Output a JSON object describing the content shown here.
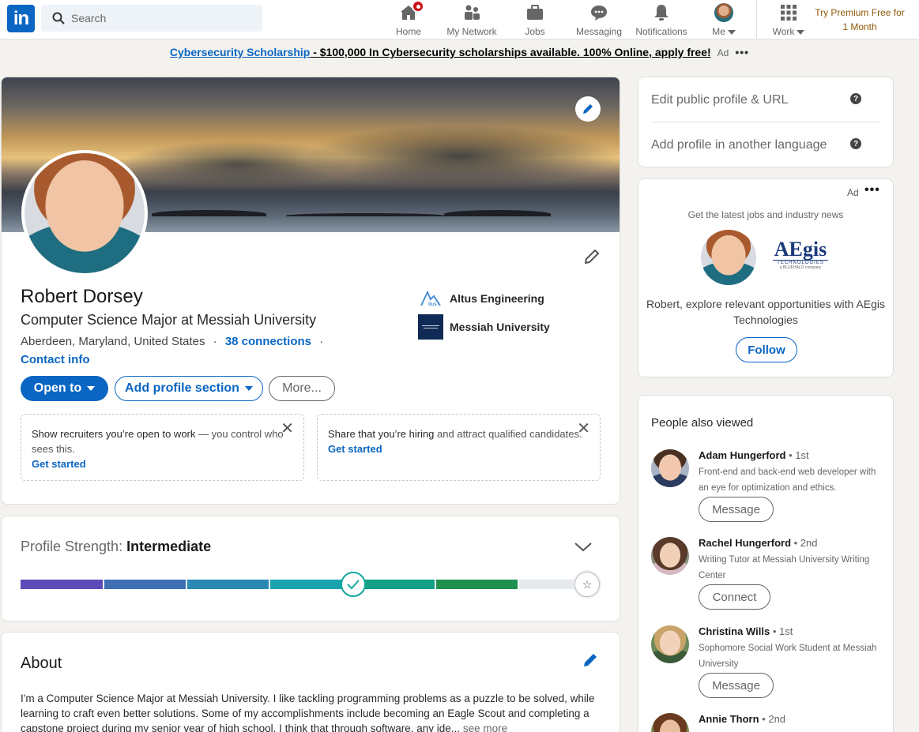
{
  "nav": {
    "logo": "in",
    "search_placeholder": "Search",
    "items": [
      {
        "label": "Home",
        "icon": "home-icon"
      },
      {
        "label": "My Network",
        "icon": "network-icon"
      },
      {
        "label": "Jobs",
        "icon": "briefcase-icon"
      },
      {
        "label": "Messaging",
        "icon": "messaging-icon"
      },
      {
        "label": "Notifications",
        "icon": "bell-icon"
      },
      {
        "label": "Me",
        "icon": "avatar"
      },
      {
        "label": "Work",
        "icon": "grid-icon"
      }
    ],
    "premium": "Try Premium Free for 1 Month"
  },
  "ad_banner": {
    "link": "Cybersecurity Scholarship",
    "separator": " - ",
    "text": "$100,000 In Cybersecurity scholarships available. 100% Online, apply free!",
    "tag": "Ad",
    "dots": "•••"
  },
  "profile": {
    "name": "Robert Dorsey",
    "headline": "Computer Science Major at Messiah University",
    "location": "Aberdeen, Maryland, United States",
    "dot": "·",
    "connections": "38 connections",
    "contact": "Contact info",
    "companies": [
      {
        "name": "Altus Engineering"
      },
      {
        "name": "Messiah University"
      }
    ],
    "buttons": {
      "open_to": "Open to",
      "add_section": "Add profile section",
      "more": "More..."
    },
    "box1": {
      "bold": "Show recruiters you’re open to work",
      "rest": " — you control who sees this.",
      "link": "Get started",
      "close": "✕"
    },
    "box2": {
      "bold": "Share that you’re hiring",
      "rest": " and attract qualified candidates.",
      "link": "Get started",
      "close": "✕"
    }
  },
  "strength": {
    "label": "Profile Strength: ",
    "level": "Intermediate",
    "progress": 0.6
  },
  "about": {
    "title": "About",
    "text": "I'm a Computer Science Major at Messiah University. I like tackling programming problems as a puzzle to be solved, while learning to craft even better solutions. Some of my accomplishments include becoming an Eagle Scout and completing a capstone project during my senior year of high school. I think that through software, any ide...",
    "see_more": "see more"
  },
  "right": {
    "edit_public": "Edit public profile & URL",
    "add_language": "Add profile in another language",
    "help": "?",
    "ad": {
      "tag": "Ad",
      "dots": "•••",
      "sub": "Get the latest jobs and industry news",
      "brand": "AEgis",
      "brand_sub": "TECHNOLOGIES",
      "brand_tag": "a BLUEHALO company",
      "message": "Robert, explore relevant opportunities with AEgis Technologies",
      "follow": "Follow"
    },
    "people_title": "People also viewed",
    "people": [
      {
        "name": "Adam Hungerford",
        "degree": "• 1st",
        "desc": "Front-end and back-end web developer with an eye for optimization and ethics.",
        "button": "Message"
      },
      {
        "name": "Rachel Hungerford",
        "degree": "• 2nd",
        "desc": "Writing Tutor at Messiah University Writing Center",
        "button": "Connect"
      },
      {
        "name": "Christina Wills",
        "degree": "• 1st",
        "desc": "Sophomore Social Work Student at Messiah University",
        "button": "Message"
      },
      {
        "name": "Annie Thorn",
        "degree": "• 2nd",
        "desc": "",
        "button": ""
      }
    ]
  }
}
